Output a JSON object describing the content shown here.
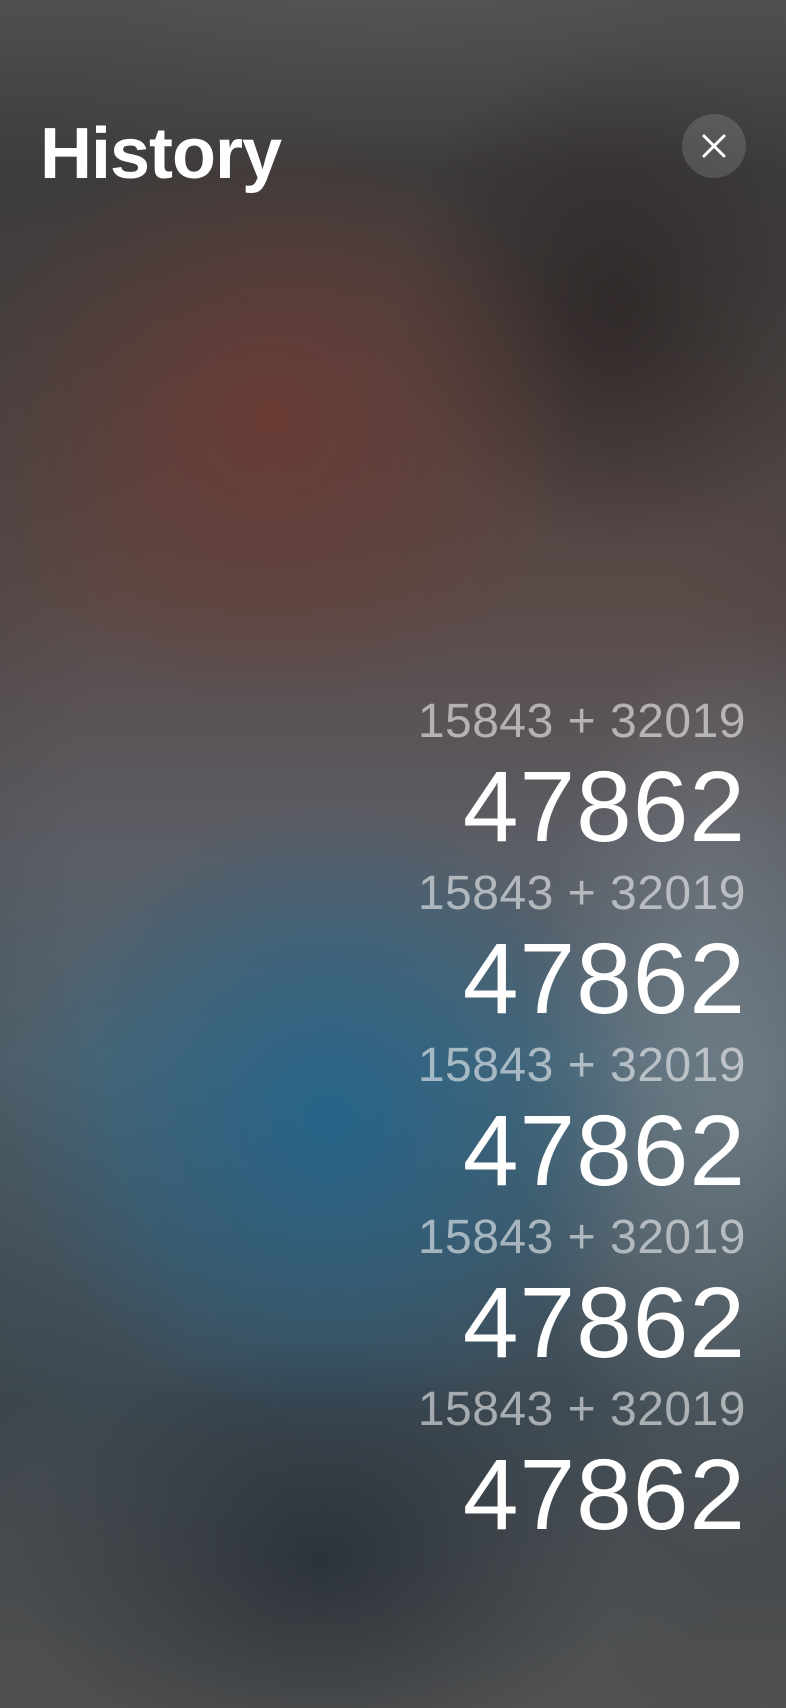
{
  "header": {
    "title": "History",
    "close_icon": "close-icon"
  },
  "history": [
    {
      "expression": "15843 + 32019",
      "result": "47862"
    },
    {
      "expression": "15843 + 32019",
      "result": "47862"
    },
    {
      "expression": "15843 + 32019",
      "result": "47862"
    },
    {
      "expression": "15843 + 32019",
      "result": "47862"
    },
    {
      "expression": "15843 + 32019",
      "result": "47862"
    }
  ],
  "colors": {
    "text_primary": "#ffffff",
    "text_secondary": "rgba(255,255,255,0.55)"
  }
}
